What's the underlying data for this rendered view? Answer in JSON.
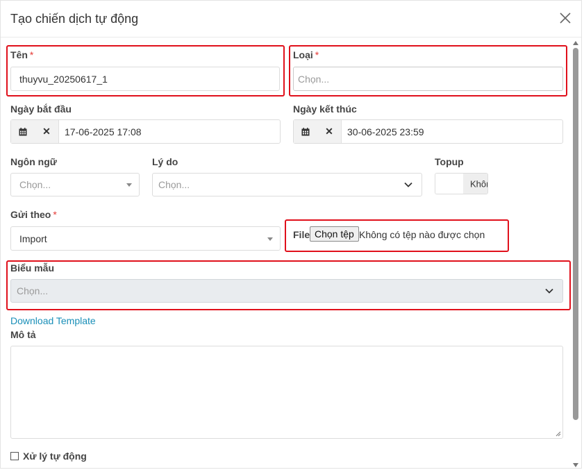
{
  "modal": {
    "title": "Tạo chiến dịch tự động"
  },
  "form": {
    "name": {
      "label": "Tên",
      "required_mark": "*",
      "value": "thuyvu_20250617_1"
    },
    "type": {
      "label": "Loại",
      "required_mark": "*",
      "placeholder": "Chọn..."
    },
    "start_date": {
      "label": "Ngày bắt đầu",
      "value": "17-06-2025 17:08"
    },
    "end_date": {
      "label": "Ngày kết thúc",
      "value": "30-06-2025 23:59"
    },
    "language": {
      "label": "Ngôn ngữ",
      "placeholder": "Chọn..."
    },
    "reason": {
      "label": "Lý do",
      "placeholder": "Chọn..."
    },
    "topup": {
      "label": "Topup",
      "value": "Khôn"
    },
    "send_by": {
      "label": "Gửi theo",
      "required_mark": "*",
      "value": "Import"
    },
    "file": {
      "label": "File",
      "button_label": "Chọn tệp",
      "status": "Không có tệp nào được chọn"
    },
    "template": {
      "label": "Biểu mẫu",
      "placeholder": "Chọn..."
    },
    "download_link": "Download Template",
    "description": {
      "label": "Mô tả",
      "value": ""
    },
    "auto_process": {
      "label": "Xử lý tự động",
      "checked": false
    }
  },
  "icons": {
    "close": "close-icon",
    "calendar": "calendar-icon",
    "clear": "clear-x-icon",
    "dropdown": "chevron-down-icon"
  },
  "colors": {
    "highlight": "#e0101b",
    "link": "#1a8fb8",
    "required": "#e53935"
  }
}
